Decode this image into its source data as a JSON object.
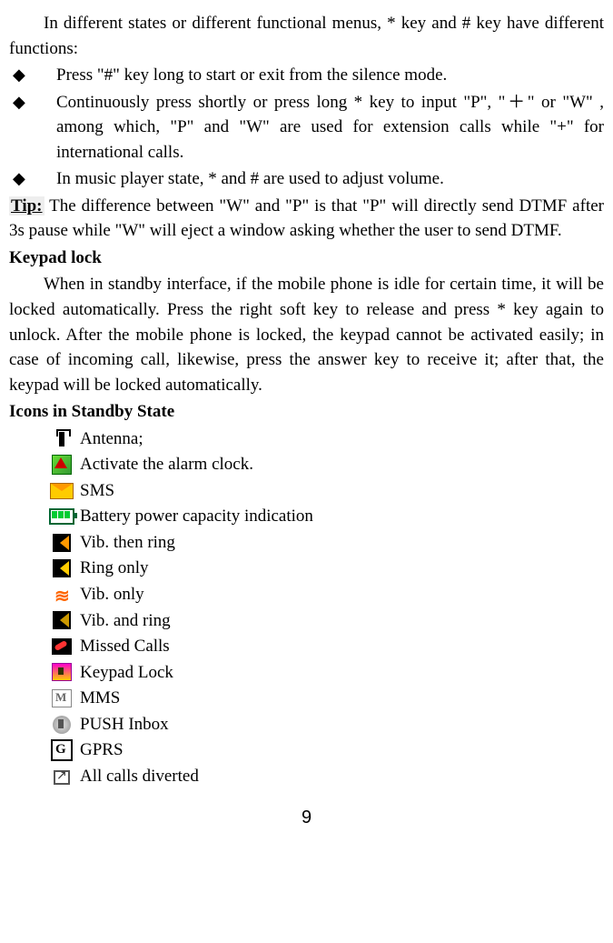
{
  "intro": "In different states or different functional menus, * key and # key have different functions:",
  "bullets": [
    "Press \"#\" key long to start or exit from the silence mode.",
    "Continuously press shortly or press long * key to input \"P\", \"＋\" or \"W\" , among which, \"P\" and \"W\" are used for extension calls while \"+\" for international calls.",
    "In music player state, * and # are used to adjust volume."
  ],
  "tip_label": "Tip:",
  "tip_text": " The difference between \"W\" and \"P\" is that \"P\" will directly send DTMF after 3s pause while \"W\" will eject a window asking whether the user to send DTMF.",
  "heading1": "Keypad lock",
  "keypad_text": "When in standby interface, if the mobile phone is idle for certain time, it will be locked automatically. Press the right soft key to release and press * key again to unlock. After the mobile phone is locked, the keypad cannot be activated easily; in case of incoming call, likewise, press the answer key to receive it; after that, the keypad will be locked automatically.",
  "heading2": "Icons in Standby State",
  "icons": [
    {
      "name": "antenna-icon",
      "label": "    Antenna;"
    },
    {
      "name": "alarm-icon",
      "label": " Activate the alarm clock."
    },
    {
      "name": "sms-icon",
      "label": " SMS"
    },
    {
      "name": "battery-icon",
      "label": "Battery power capacity indication"
    },
    {
      "name": "vib-then-ring-icon",
      "label": "Vib. then ring"
    },
    {
      "name": "ring-only-icon",
      "label": "Ring only"
    },
    {
      "name": "vib-only-icon",
      "label": "Vib. only"
    },
    {
      "name": "vib-and-ring-icon",
      "label": "Vib. and ring"
    },
    {
      "name": "missed-calls-icon",
      "label": "Missed Calls"
    },
    {
      "name": "keypad-lock-icon",
      "label": "Keypad Lock"
    },
    {
      "name": "mms-icon",
      "label": " MMS"
    },
    {
      "name": "push-inbox-icon",
      "label": " PUSH Inbox"
    },
    {
      "name": "gprs-icon",
      "label": " GPRS"
    },
    {
      "name": "divert-icon",
      "label": " All calls diverted"
    }
  ],
  "page_number": "9"
}
